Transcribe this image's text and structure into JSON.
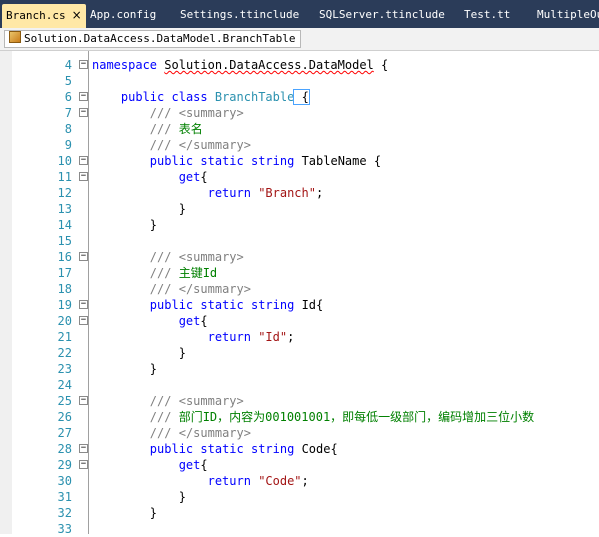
{
  "tabs": [
    {
      "label": "Branch.cs",
      "active": true,
      "close": "×"
    },
    {
      "label": "App.config"
    },
    {
      "label": "Settings.ttinclude"
    },
    {
      "label": "SQLServer.ttinclude"
    },
    {
      "label": "Test.tt"
    },
    {
      "label": "MultipleOu"
    }
  ],
  "nav": {
    "label": "Solution.DataAccess.DataModel.BranchTable"
  },
  "lines": [
    {
      "n": "4"
    },
    {
      "n": "5"
    },
    {
      "n": "6"
    },
    {
      "n": "7"
    },
    {
      "n": "8"
    },
    {
      "n": "9"
    },
    {
      "n": "10"
    },
    {
      "n": "11"
    },
    {
      "n": "12"
    },
    {
      "n": "13"
    },
    {
      "n": "14"
    },
    {
      "n": "15"
    },
    {
      "n": "16"
    },
    {
      "n": "17"
    },
    {
      "n": "18"
    },
    {
      "n": "19"
    },
    {
      "n": "20"
    },
    {
      "n": "21"
    },
    {
      "n": "22"
    },
    {
      "n": "23"
    },
    {
      "n": "24"
    },
    {
      "n": "25"
    },
    {
      "n": "26"
    },
    {
      "n": "27"
    },
    {
      "n": "28"
    },
    {
      "n": "29"
    },
    {
      "n": "30"
    },
    {
      "n": "31"
    },
    {
      "n": "32"
    },
    {
      "n": "33"
    }
  ],
  "code": {
    "l4_ns": "namespace",
    "l4_name": "Solution.DataAccess.DataModel",
    "l4_brace": " {",
    "l6_public": "public",
    "l6_class": "class",
    "l6_name": "BranchTable",
    "l6_brace": " {",
    "sum_open": "<summary>",
    "sum_close": "</summary>",
    "doc_slash": "///",
    "l8_text": " 表名",
    "public": "public",
    "static": "static",
    "string": "string",
    "l10_name": " TableName {",
    "get": "get",
    "get_brace": "{",
    "return": "return",
    "l12_str": "\"Branch\"",
    "semicolon": ";",
    "close": "}",
    "l17_text": " 主键Id",
    "l19_name": " Id{",
    "l21_str": "\"Id\"",
    "l26_text": " 部门ID，内容为001001001，即每低一级部门，编码增加三位小数",
    "l28_name": " Code{",
    "l30_str": "\"Code\""
  },
  "colors": {
    "keyword": "#0000ff",
    "type": "#2b91af",
    "comment": "#008000",
    "string": "#a31515",
    "linenumber": "#2b91af"
  }
}
